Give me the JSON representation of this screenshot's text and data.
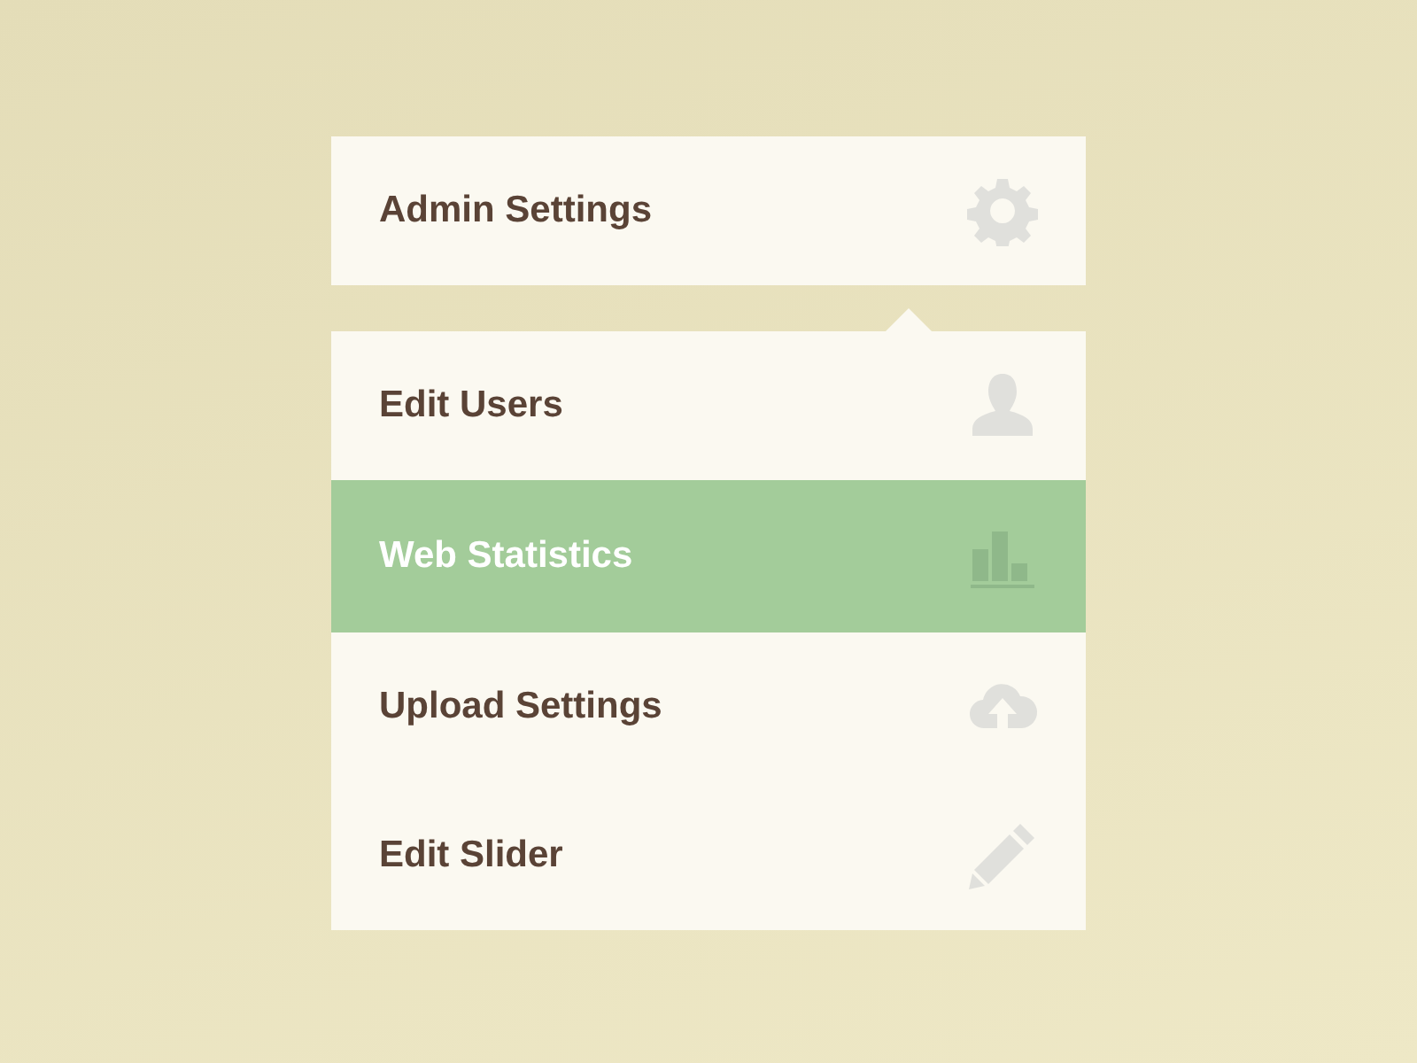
{
  "header": {
    "title": "Admin Settings",
    "kind": "gear"
  },
  "menu": [
    {
      "label": "Edit Users",
      "kind": "user",
      "selected": false
    },
    {
      "label": "Web Statistics",
      "kind": "chart",
      "selected": true
    },
    {
      "label": "Upload Settings",
      "kind": "cloud",
      "selected": false
    },
    {
      "label": "Edit Slider",
      "kind": "pencil",
      "selected": false
    }
  ]
}
